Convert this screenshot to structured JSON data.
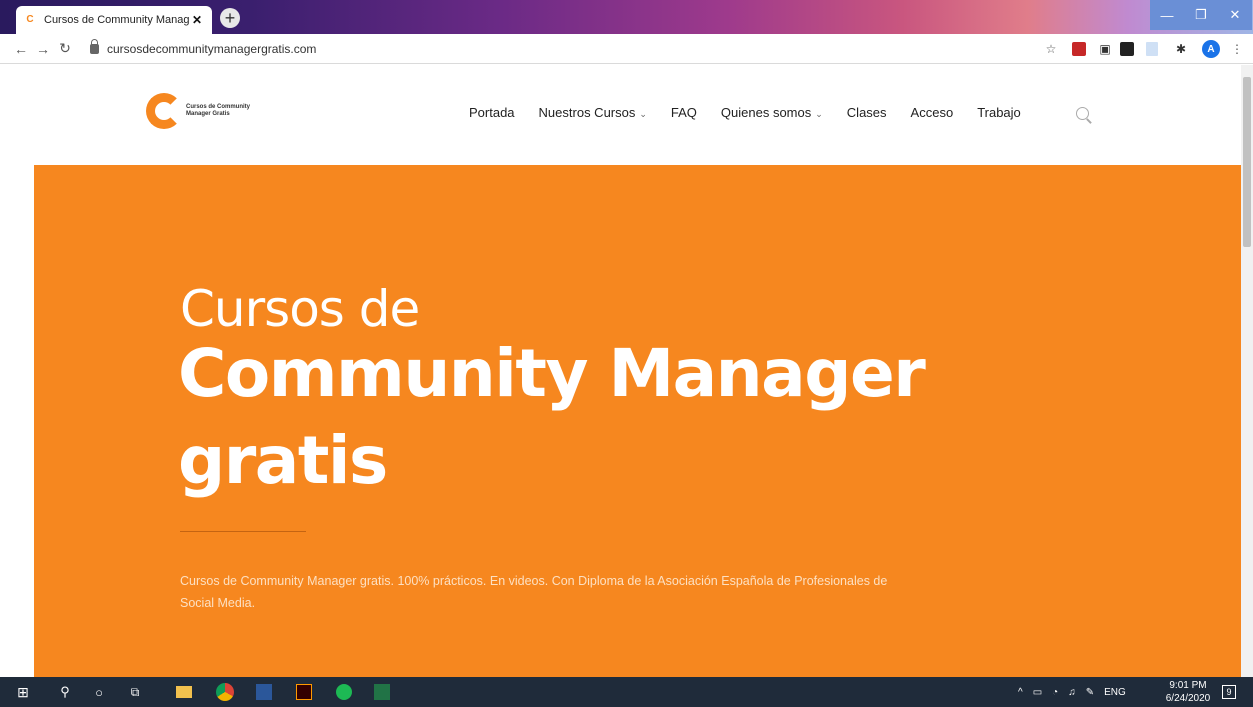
{
  "browser": {
    "tab_title": "Cursos de Community Manager",
    "tab_favicon": "C",
    "close_glyph": "✕",
    "new_tab_glyph": "+",
    "url": "cursosdecommunitymanagergratis.com",
    "avatar_letter": "A",
    "window_controls": {
      "minimize": "—",
      "maximize": "❐",
      "close": "✕"
    }
  },
  "site": {
    "logo_text_line1": "Cursos de Community",
    "logo_text_line2": "Manager Gratis",
    "nav": [
      {
        "label": "Portada"
      },
      {
        "label": "Nuestros Cursos",
        "dropdown": true
      },
      {
        "label": "FAQ"
      },
      {
        "label": "Quienes somos",
        "dropdown": true
      },
      {
        "label": "Clases"
      },
      {
        "label": "Acceso"
      },
      {
        "label": "Trabajo"
      }
    ],
    "chevron": "⌄"
  },
  "hero": {
    "line1": "Cursos de",
    "line2": "Community Manager",
    "line3": "gratis",
    "description": "Cursos de Community Manager gratis. 100% prácticos. En videos. Con Diploma de la Asociación Española de Profesionales de Social Media."
  },
  "taskbar": {
    "language": "ENG",
    "time": "9:01 PM",
    "date": "6/24/2020",
    "notifications": "9"
  },
  "colors": {
    "accent": "#f6871f",
    "taskbar": "#1f2b3a"
  }
}
